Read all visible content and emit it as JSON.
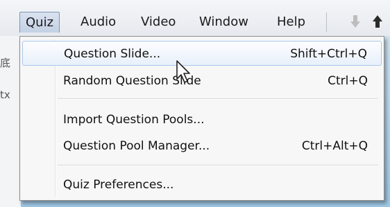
{
  "menubar": {
    "items": [
      {
        "label": "Quiz",
        "active": true
      },
      {
        "label": "Audio"
      },
      {
        "label": "Video"
      },
      {
        "label": "Window"
      },
      {
        "label": "Help"
      }
    ],
    "icons": [
      "arrow-down-icon",
      "arrow-up-icon"
    ]
  },
  "quiz_menu": {
    "items": [
      {
        "label": "Question Slide...",
        "shortcut": "Shift+Ctrl+Q",
        "highlighted": true
      },
      {
        "label": "Random Question Slide",
        "shortcut": "Ctrl+Q"
      },
      {
        "label": "Import Question Pools...",
        "shortcut": ""
      },
      {
        "label": "Question Pool Manager...",
        "shortcut": "Ctrl+Alt+Q"
      },
      {
        "label": "Quiz Preferences...",
        "shortcut": ""
      }
    ]
  },
  "left_strip": {
    "glyph_1": "底",
    "glyph_2": "tx"
  },
  "colors": {
    "highlight_border": "#a8c8ec",
    "active_menu_bg": "#c4d1e4",
    "canvas_bg": "#9fc8e6"
  }
}
